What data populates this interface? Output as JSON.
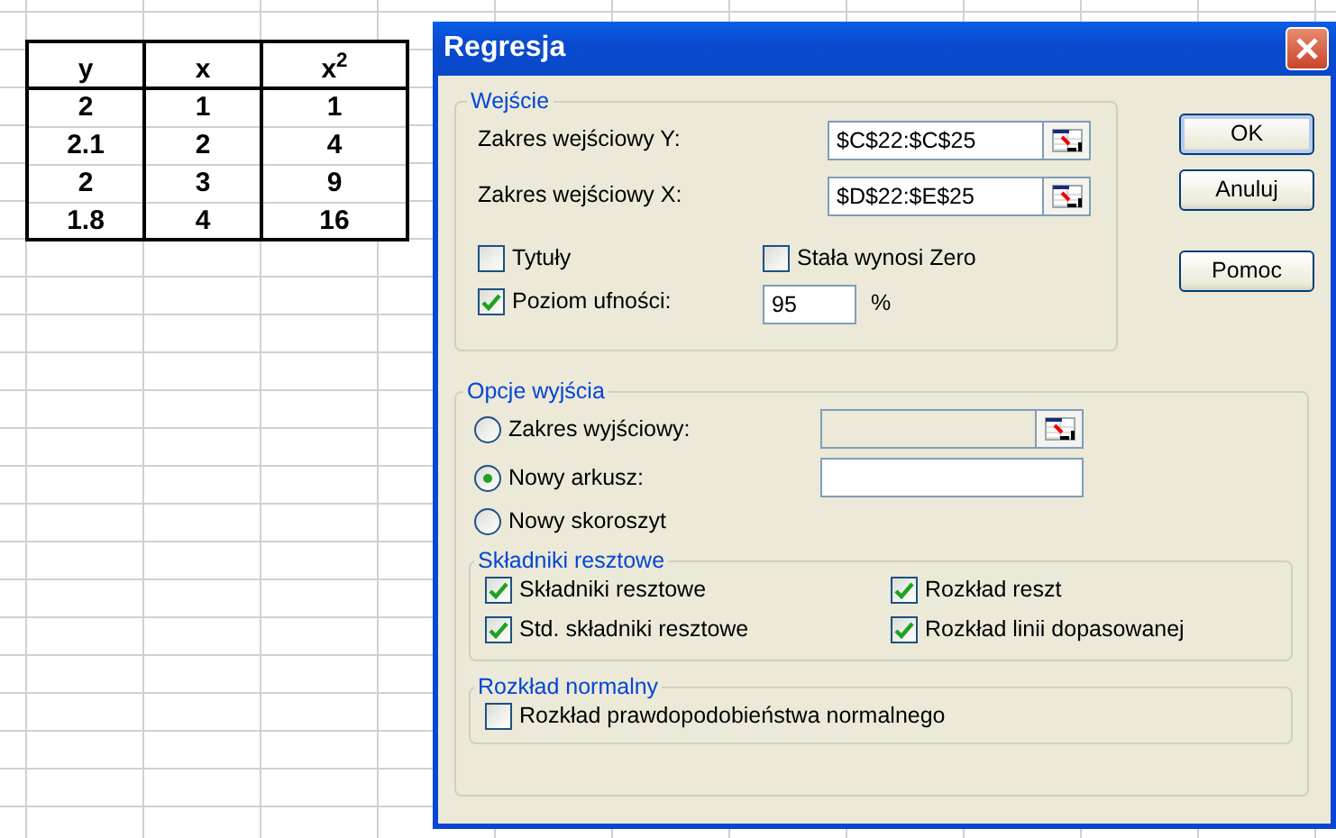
{
  "spreadsheet": {
    "columns": [
      "y",
      "x",
      "x$^{2}$"
    ],
    "rows": [
      [
        "2",
        "1",
        "1"
      ],
      [
        "2.1",
        "2",
        "4"
      ],
      [
        "2",
        "3",
        "9"
      ],
      [
        "1.8",
        "4",
        "16"
      ]
    ]
  },
  "window": {
    "title": "Regresja"
  },
  "input_group": {
    "legend": "Wejście",
    "fields": [
      {
        "label": "Zakres wejściowy Y:",
        "value": "$C$22:$C$25"
      },
      {
        "label": "Zakres wejściowy X:",
        "value": "$D$22:$E$25"
      }
    ],
    "options": [
      {
        "label": "Tytuły",
        "checked": false
      },
      {
        "label": "Stała wynosi Zero",
        "checked": false
      },
      {
        "label": "Poziom ufności:",
        "checked": true
      }
    ],
    "confidence": {
      "value": "95",
      "unit": "%"
    }
  },
  "buttons": [
    {
      "label": "OK",
      "default": true
    },
    {
      "label": "Anuluj",
      "default": false
    },
    {
      "label": "Pomoc",
      "default": false
    }
  ],
  "output_group": {
    "legend": "Opcje wyjścia",
    "destinations": [
      {
        "label": "Zakres wyjściowy:",
        "selected": false,
        "field": {
          "kind": "range",
          "disabled": true
        }
      },
      {
        "label": "Nowy arkusz:",
        "selected": true,
        "field": {
          "kind": "text",
          "disabled": false
        }
      },
      {
        "label": "Nowy skoroszyt",
        "selected": false
      }
    ],
    "residuals": {
      "legend": "Składniki resztowe",
      "options": [
        {
          "label": "Składniki resztowe",
          "checked": true
        },
        {
          "label": "Rozkład reszt",
          "checked": true
        },
        {
          "label": "Std. składniki resztowe",
          "checked": true
        },
        {
          "label": "Rozkład linii dopasowanej",
          "checked": true
        }
      ]
    },
    "normal": {
      "legend": "Rozkład normalny",
      "options": [
        {
          "label": "Rozkład prawdopodobieństwa normalnego",
          "checked": false
        }
      ]
    }
  }
}
